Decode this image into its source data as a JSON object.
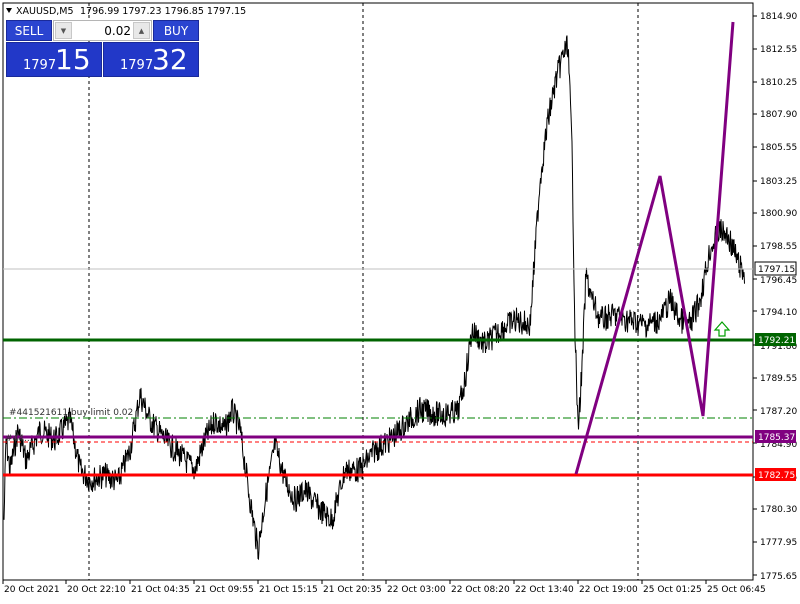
{
  "header": {
    "symbol_info": "XAUUSD,M5",
    "ohlc": "1796.99 1797.23 1796.85 1797.15"
  },
  "trade_panel": {
    "sell_label": "SELL",
    "buy_label": "BUY",
    "lot_size": "0.02",
    "sell_price_small": "1797",
    "sell_price_big": "15",
    "buy_price_small": "1797",
    "buy_price_big": "32"
  },
  "price_axis": {
    "ticks": [
      "1814.90",
      "1812.55",
      "1810.25",
      "1807.90",
      "1805.55",
      "1803.25",
      "1800.90",
      "1798.55",
      "1796.45",
      "1794.10",
      "1791.80",
      "1789.55",
      "1787.20",
      "1784.90",
      "1782.55",
      "1780.30",
      "1777.95",
      "1775.65"
    ],
    "current_price": "1797.15",
    "level_labels": [
      "1792.21",
      "1785.37",
      "1782.75"
    ]
  },
  "time_axis": {
    "labels": [
      "20 Oct 2021",
      "20 Oct 22:10",
      "21 Oct 04:35",
      "21 Oct 09:55",
      "21 Oct 15:15",
      "21 Oct 20:35",
      "22 Oct 03:00",
      "22 Oct 08:20",
      "22 Oct 13:40",
      "22 Oct 19:00",
      "25 Oct 01:25",
      "25 Oct 06:45"
    ]
  },
  "orders": {
    "buy_limit_label": "#441521611 buy limit 0.02",
    "stop_label": "#44..."
  },
  "colors": {
    "bg": "#ffffff",
    "candles": "#000000",
    "support_line": "#006400",
    "pattern_line": "#800080",
    "resistance_line": "#ff0000",
    "order_line": "#008000",
    "arrow": "#00a000",
    "panel_blue": "#2238c8"
  }
}
